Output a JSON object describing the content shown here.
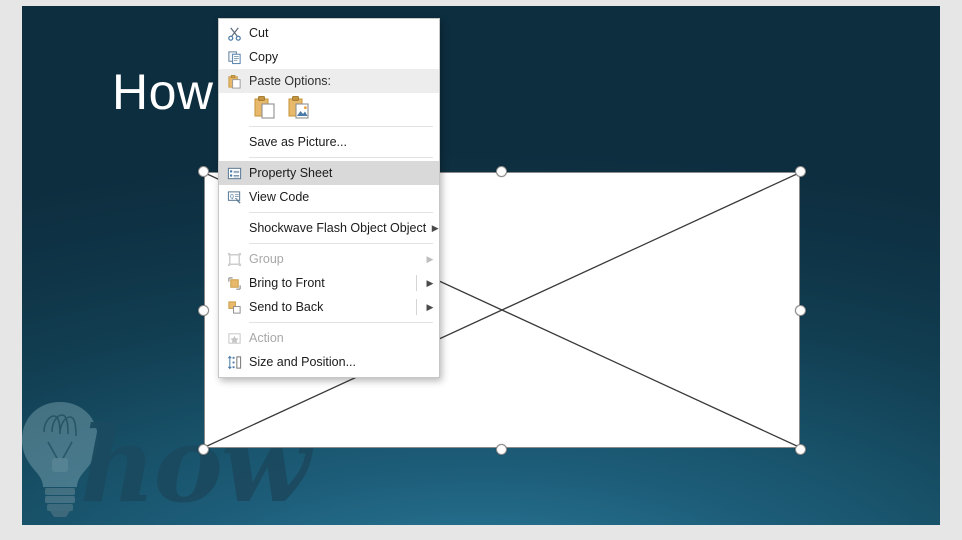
{
  "slide": {
    "title": "How t                    works ?",
    "title_full_visible": "How t … works ?",
    "watermark_text": "how",
    "watermark_icon": "lightbulb-icon",
    "background_color": "#11455c",
    "accent_color": "#2e88ab"
  },
  "placeholder": {
    "name": "shockwave-flash-object-placeholder",
    "fill": "#ffffff",
    "border_color": "#8a8a8a"
  },
  "context_menu": {
    "items": [
      {
        "id": "cut",
        "label": "Cut",
        "icon": "scissors-icon",
        "accel": "C",
        "state": "enabled",
        "submenu": false
      },
      {
        "id": "copy",
        "label": "Copy",
        "icon": "copy-icon",
        "accel": "C",
        "state": "enabled",
        "submenu": false
      },
      {
        "id": "paste-options",
        "label": "Paste Options:",
        "icon": "clipboard-icon",
        "accel": "",
        "state": "header",
        "submenu": false
      },
      {
        "id": "save-as-picture",
        "label": "Save as Picture...",
        "icon": "",
        "accel": "S",
        "state": "enabled",
        "submenu": false
      },
      {
        "id": "property-sheet",
        "label": "Property Sheet",
        "icon": "property-sheet-icon",
        "accel": "",
        "state": "selected",
        "submenu": false
      },
      {
        "id": "view-code",
        "label": "View Code",
        "icon": "view-code-icon",
        "accel": "V",
        "state": "enabled",
        "submenu": false
      },
      {
        "id": "shockwave-flash-object-object",
        "label": "Shockwave Flash Object Object",
        "icon": "",
        "accel": "O",
        "state": "enabled",
        "submenu": true
      },
      {
        "id": "group",
        "label": "Group",
        "icon": "group-icon",
        "accel": "",
        "state": "disabled",
        "submenu": true
      },
      {
        "id": "bring-to-front",
        "label": "Bring to Front",
        "icon": "bring-to-front-icon",
        "accel": "r",
        "state": "enabled",
        "submenu": true
      },
      {
        "id": "send-to-back",
        "label": "Send to Back",
        "icon": "send-to-back-icon",
        "accel": "k",
        "state": "enabled",
        "submenu": true
      },
      {
        "id": "action",
        "label": "Action",
        "icon": "action-star-icon",
        "accel": "",
        "state": "disabled",
        "submenu": false
      },
      {
        "id": "size-and-position",
        "label": "Size and Position...",
        "icon": "size-position-icon",
        "accel": "z",
        "state": "enabled",
        "submenu": false
      }
    ],
    "paste_options": [
      {
        "id": "paste-keep-source-formatting",
        "icon": "clipboard-document-icon"
      },
      {
        "id": "paste-picture",
        "icon": "clipboard-picture-icon"
      }
    ],
    "labels": {
      "cut": "Cut",
      "copy": "Copy",
      "paste_options": "Paste Options:",
      "save_as_picture": "Save as Picture...",
      "property_sheet": "Property Sheet",
      "view_code": "View Code",
      "shockwave": "Shockwave Flash Object Object",
      "group": "Group",
      "bring_to_front": "Bring to Front",
      "send_to_back": "Send to Back",
      "action": "Action",
      "size_and_position": "Size and Position..."
    },
    "highlight_color": "#d9d9d9",
    "header_color": "#ededed"
  }
}
